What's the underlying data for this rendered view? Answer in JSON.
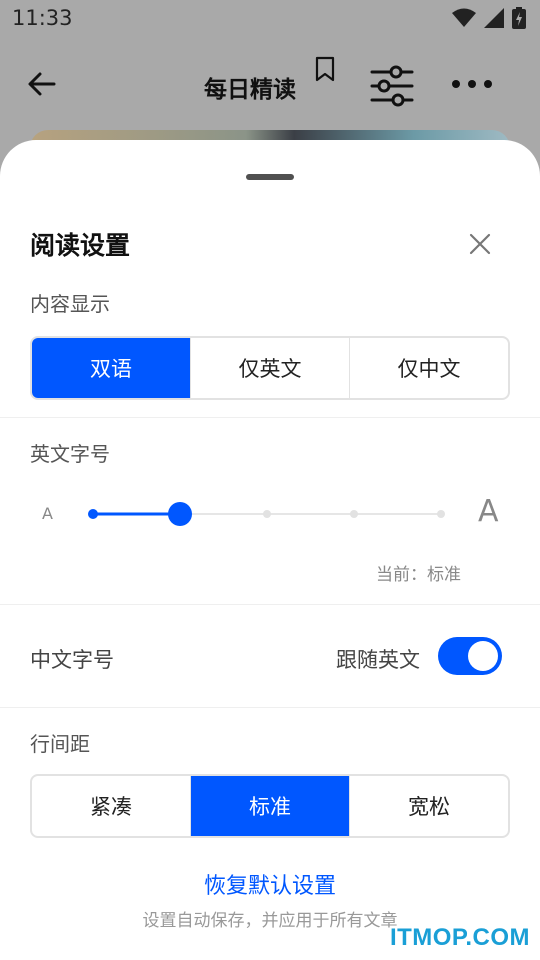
{
  "status_bar": {
    "time": "11:33"
  },
  "app_bar": {
    "title": "每日精读"
  },
  "sheet": {
    "title": "阅读设置",
    "content_display": {
      "label": "内容显示",
      "options": [
        "双语",
        "仅英文",
        "仅中文"
      ],
      "selected_index": 0
    },
    "english_font_size": {
      "label": "英文字号",
      "small_marker": "A",
      "large_marker": "A",
      "steps": 5,
      "selected_step": 1,
      "current_text": "当前：标准"
    },
    "chinese_font_size": {
      "label": "中文字号",
      "follow_label": "跟随英文",
      "follow_enabled": true
    },
    "line_spacing": {
      "label": "行间距",
      "options": [
        "紧凑",
        "标准",
        "宽松"
      ],
      "selected_index": 1
    },
    "reset_label": "恢复默认设置",
    "reset_hint": "设置自动保存，并应用于所有文章"
  },
  "colors": {
    "accent": "#0057ff",
    "overlay": "#a9a9a9"
  },
  "watermark": "ITMOP.COM"
}
